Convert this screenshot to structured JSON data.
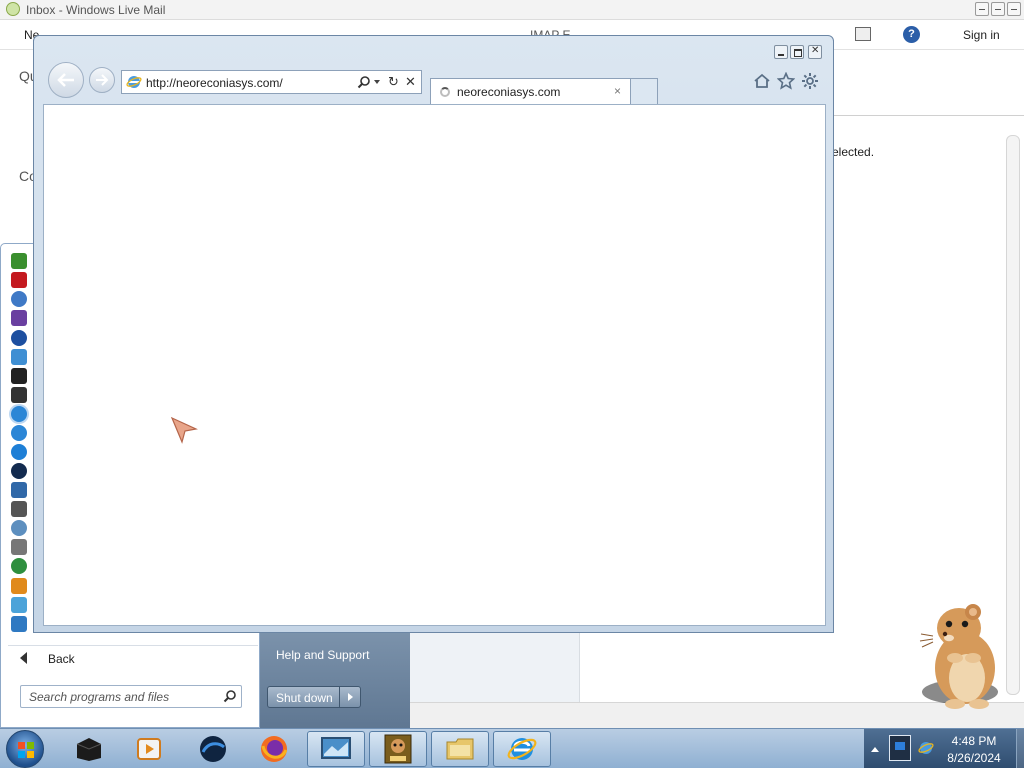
{
  "wlm": {
    "title": "Inbox - Windows Live Mail",
    "menu_new": "Ne",
    "menu_imap": "IMAP E ...",
    "signin": "Sign in",
    "frag_q": "Qu",
    "frag_c": "Co",
    "selected_text": "elected."
  },
  "start_menu": {
    "back_label": "Back",
    "search_placeholder": "Search programs and files",
    "help_label": "Help and Support",
    "shutdown_label": "Shut down"
  },
  "ie": {
    "url": "http://neoreconiasys.com/",
    "tab_label": "neoreconiasys.com",
    "tab_close": "×"
  },
  "taskbar": {
    "time": "4:48 PM",
    "date": "8/26/2024"
  },
  "colors": {
    "taskbar": "#8fb0d2",
    "ie_frame": "#c5d5e6",
    "start_right": "#6f87a1"
  },
  "start_menu_icons": [
    "utorrent-icon",
    "acrobat-icon",
    "sync-icon",
    "visual-studio-icon",
    "vpn-icon",
    "installer-icon",
    "cmd-icon",
    "terminal-icon",
    "ie-icon",
    "ie-icon-2",
    "globe-icon",
    "media-icon",
    "notepad-icon",
    "console-icon",
    "network-icon",
    "printer-icon",
    "media-player-icon",
    "vlc-icon",
    "paint-icon",
    "send-icon"
  ]
}
